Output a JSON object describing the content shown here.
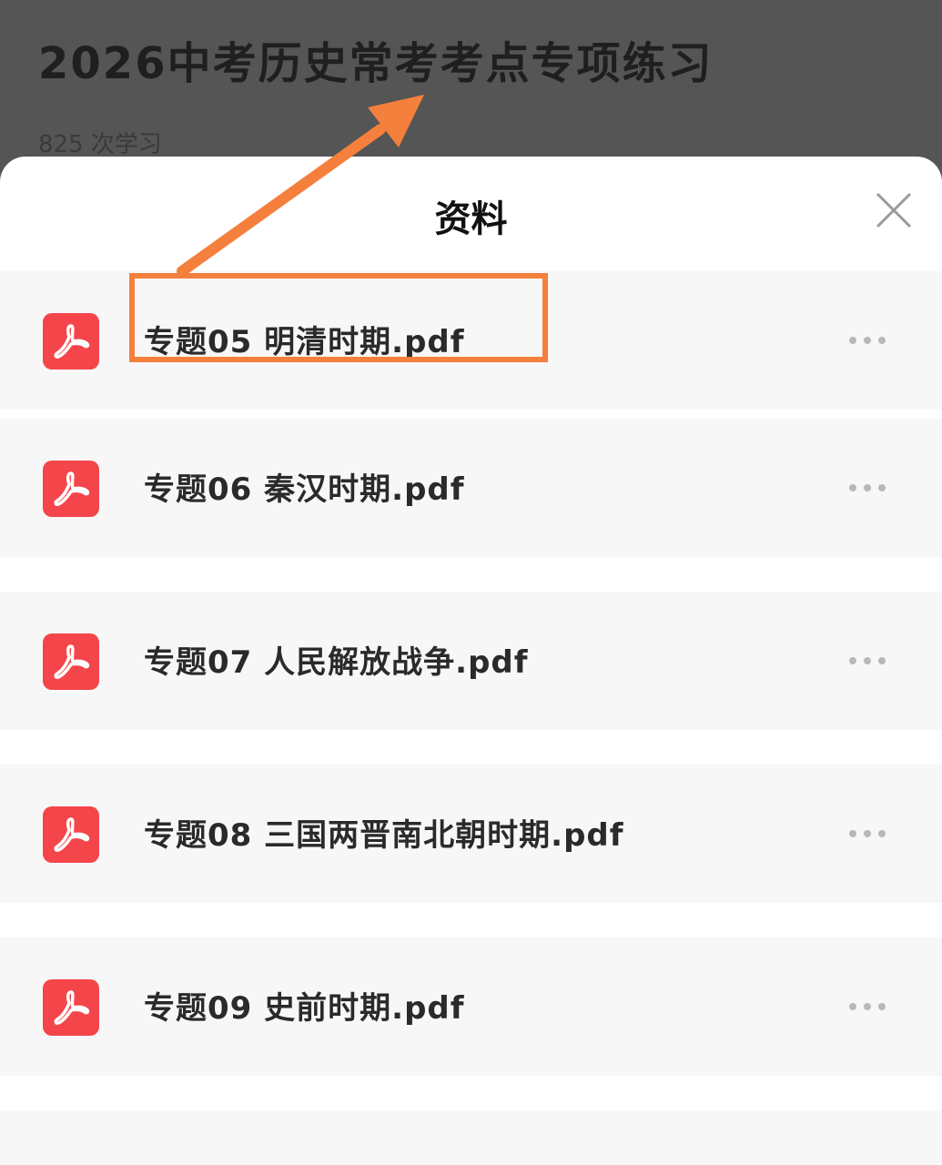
{
  "course": {
    "title": "2026中考历史常考考点专项练习",
    "study_count": "825 次学习"
  },
  "sheet": {
    "title": "资料",
    "close_icon": "close-icon"
  },
  "files": [
    {
      "name": "专题05 明清时期.pdf",
      "icon": "pdf-icon",
      "highlighted": true
    },
    {
      "name": "专题06 秦汉时期.pdf",
      "icon": "pdf-icon"
    },
    {
      "name": "专题07 人民解放战争.pdf",
      "icon": "pdf-icon"
    },
    {
      "name": "专题08 三国两晋南北朝时期.pdf",
      "icon": "pdf-icon"
    },
    {
      "name": "专题09 史前时期.pdf",
      "icon": "pdf-icon"
    }
  ],
  "colors": {
    "pdf_red": "#f4454a",
    "annotation_orange": "#f57f3c",
    "overlay_gray": "#555555"
  }
}
